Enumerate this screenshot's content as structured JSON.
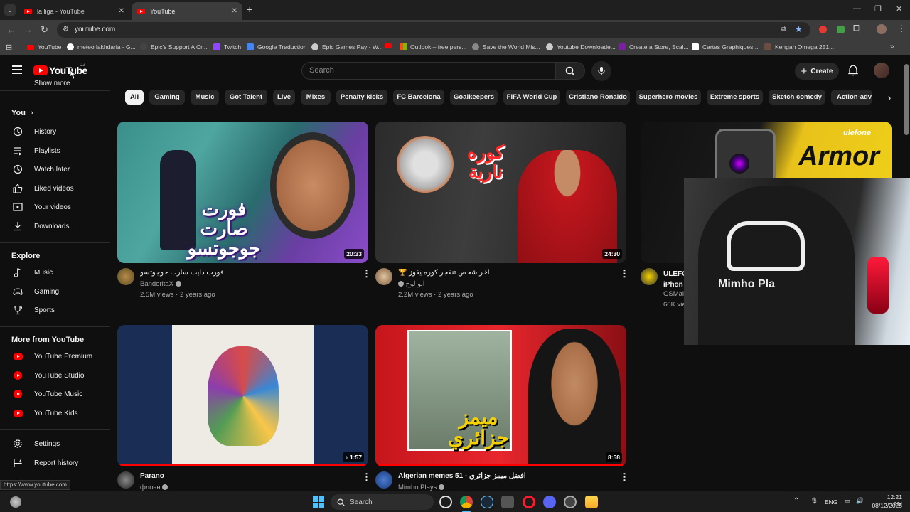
{
  "browser": {
    "tabs": [
      {
        "label": "la liga - YouTube",
        "active": false
      },
      {
        "label": "YouTube",
        "active": true
      }
    ],
    "url": "youtube.com",
    "bookmarks": [
      "YouTube",
      "meteo lakhdaria - G...",
      "Epic's Support A Cr...",
      "Twitch",
      "Google Traduction",
      "Epic Games Pay - W...",
      "",
      "Outlook – free pers...",
      "Save the World Mis...",
      "Youtube Downloade...",
      "Create a Store, Scal...",
      "Cartes Graphiques...",
      "Kengan Omega 251..."
    ],
    "status_url": "https://www.youtube.com"
  },
  "header": {
    "logo_text": "YouTube",
    "country": "DZ",
    "search_placeholder": "Search",
    "create_label": "Create"
  },
  "sidebar": {
    "top_cut": "Show more",
    "you_label": "You",
    "you_items": [
      "History",
      "Playlists",
      "Watch later",
      "Liked videos",
      "Your videos",
      "Downloads"
    ],
    "explore_label": "Explore",
    "explore_items": [
      "Music",
      "Gaming",
      "Sports"
    ],
    "more_label": "More from YouTube",
    "more_items": [
      "YouTube Premium",
      "YouTube Studio",
      "YouTube Music",
      "YouTube Kids"
    ],
    "settings_items": [
      "Settings",
      "Report history"
    ]
  },
  "chips": [
    "All",
    "Gaming",
    "Music",
    "Got Talent",
    "Live",
    "Mixes",
    "Penalty kicks",
    "FC Barcelona",
    "Goalkeepers",
    "FIFA World Cup",
    "Cristiano Ronaldo",
    "Superhero movies",
    "Extreme sports",
    "Sketch comedy",
    "Action-adve"
  ],
  "videos": [
    {
      "title": "فورت دايت سارت جوجوتسو",
      "channel": "BanderitaX",
      "meta": "2.5M views · 2 years ago",
      "duration": "20:33",
      "thumb_text": "فورت صارت جوجوتسو"
    },
    {
      "title": "🏆 اخر شخص تنفجر كوره يفوز",
      "channel": "ابو لوح",
      "meta": "2.2M views · 2 years ago",
      "duration": "24:30",
      "thumb_text": "كوره نارية"
    },
    {
      "title": "ULEFO",
      "title2": "iPhon",
      "channel": "GSMal",
      "meta": "60K vie",
      "thumb_text": "Armor",
      "thumb_brand": "ulefone"
    },
    {
      "title": "Parano",
      "channel": "флоэн",
      "duration": "1:57"
    },
    {
      "title": "Algerian memes 51 - افضل ميمز جزائري",
      "channel": "Mimho Plays",
      "duration": "8:58",
      "thumb_text": "ميمز جزائري"
    }
  ],
  "overlay_text": "Mimho Pla",
  "taskbar": {
    "search_label": "Search",
    "lang": "ENG",
    "time": "12:21 AM",
    "date": "08/12/2025"
  }
}
